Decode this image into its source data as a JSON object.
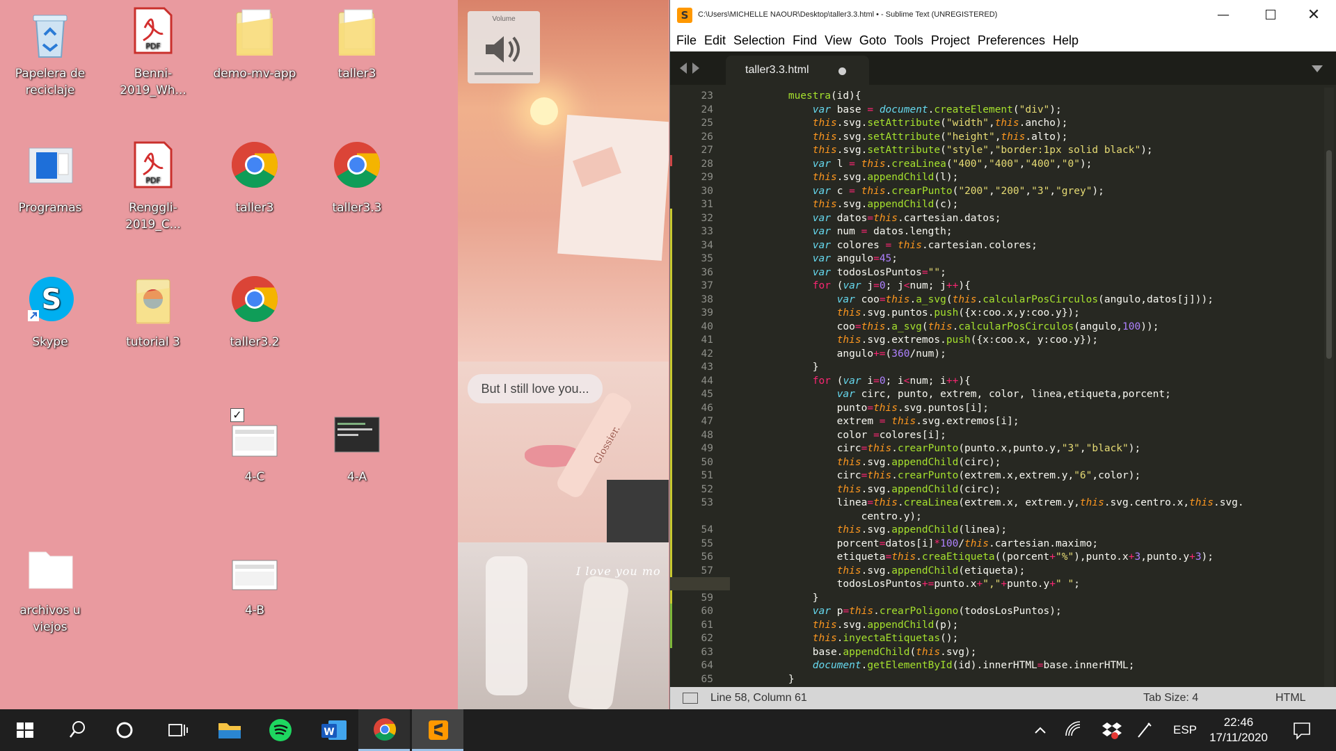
{
  "desktop": {
    "icons": [
      {
        "label": "Papelera de reciclaje",
        "icon": "recycle-bin-icon"
      },
      {
        "label": "Benni-2019_Wh...",
        "icon": "pdf-file-icon"
      },
      {
        "label": "demo-mv-app",
        "icon": "folder-icon"
      },
      {
        "label": "taller3",
        "icon": "folder-icon"
      },
      {
        "label": "Programas",
        "icon": "programs-icon"
      },
      {
        "label": "Renggli-2019_C...",
        "icon": "pdf-file-icon"
      },
      {
        "label": "taller3",
        "icon": "chrome-icon"
      },
      {
        "label": "taller3.3",
        "icon": "chrome-icon"
      },
      {
        "label": "Skype",
        "icon": "skype-icon"
      },
      {
        "label": "tutorial 3",
        "icon": "folder-icon"
      },
      {
        "label": "taller3.2",
        "icon": "chrome-icon"
      },
      {
        "label": "4-C",
        "icon": "screenshot-icon"
      },
      {
        "label": "4-A",
        "icon": "screenshot-icon"
      },
      {
        "label": "archivos u viejos",
        "icon": "folder-icon"
      },
      {
        "label": "4-B",
        "icon": "screenshot-icon"
      }
    ],
    "pdf_badge": "PDF"
  },
  "wallpaper": {
    "volume_label": "Volume",
    "bubble_text": "But I still love you...",
    "script_text": "I love you mo",
    "product_text": "Glossier."
  },
  "window": {
    "title": "C:\\Users\\MICHELLE NAOUR\\Desktop\\taller3.3.html • - Sublime Text (UNREGISTERED)",
    "menu": [
      "File",
      "Edit",
      "Selection",
      "Find",
      "View",
      "Goto",
      "Tools",
      "Project",
      "Preferences",
      "Help"
    ],
    "tab": "taller3.3.html",
    "line_numbers": [
      "23",
      "24",
      "25",
      "26",
      "27",
      "28",
      "29",
      "30",
      "31",
      "32",
      "33",
      "34",
      "35",
      "36",
      "37",
      "38",
      "39",
      "40",
      "41",
      "42",
      "43",
      "44",
      "45",
      "46",
      "47",
      "48",
      "49",
      "50",
      "51",
      "52",
      "53",
      "",
      "54",
      "55",
      "56",
      "57",
      "58",
      "59",
      "60",
      "61",
      "62",
      "63",
      "64",
      "65"
    ],
    "code_lines": [
      "        muestra(id){",
      "            var base = document.createElement(\"div\");",
      "            this.svg.setAttribute(\"width\",this.ancho);",
      "            this.svg.setAttribute(\"height\",this.alto);",
      "            this.svg.setAttribute(\"style\",\"border:1px solid black\");",
      "            var l = this.creaLinea(\"400\",\"400\",\"400\",\"0\");",
      "            this.svg.appendChild(l);",
      "            var c = this.crearPunto(\"200\",\"200\",\"3\",\"grey\");",
      "            this.svg.appendChild(c);",
      "            var datos=this.cartesian.datos;",
      "            var num = datos.length;",
      "            var colores = this.cartesian.colores;",
      "            var angulo=45;",
      "            var todosLosPuntos=\"\";",
      "            for (var j=0; j<num; j++){",
      "                var coo=this.a_svg(this.calcularPosCirculos(angulo,datos[j]));",
      "                this.svg.puntos.push({x:coo.x,y:coo.y});",
      "                coo=this.a_svg(this.calcularPosCirculos(angulo,100));",
      "                this.svg.extremos.push({x:coo.x, y:coo.y});",
      "                angulo+=(360/num);",
      "            }",
      "            for (var i=0; i<num; i++){",
      "                var circ, punto, extrem, color, linea,etiqueta,porcent;",
      "                punto=this.svg.puntos[i];",
      "                extrem = this.svg.extremos[i];",
      "                color =colores[i];",
      "                circ=this.crearPunto(punto.x,punto.y,\"3\",\"black\");",
      "                this.svg.appendChild(circ);",
      "                circ=this.crearPunto(extrem.x,extrem.y,\"6\",color);",
      "                this.svg.appendChild(circ);",
      "                linea=this.creaLinea(extrem.x, extrem.y,this.svg.centro.x,this.svg.",
      "                    centro.y);",
      "                this.svg.appendChild(linea);",
      "                porcent=datos[i]*100/this.cartesian.maximo;",
      "                etiqueta=this.creaEtiqueta((porcent+\"%\"),punto.x+3,punto.y+3);",
      "                this.svg.appendChild(etiqueta);",
      "                todosLosPuntos+=punto.x+\",\"+punto.y+\" \";",
      "            }",
      "            var p=this.crearPoligono(todosLosPuntos);",
      "            this.svg.appendChild(p);",
      "            this.inyectaEtiquetas();",
      "            base.appendChild(this.svg);",
      "            document.getElementById(id).innerHTML=base.innerHTML;",
      "        }"
    ],
    "status": {
      "position": "Line 58, Column 61",
      "tab_size": "Tab Size: 4",
      "syntax": "HTML"
    },
    "syntax_colors": {
      "keyword": "#f92672",
      "string": "#e6db74",
      "number": "#ae81ff",
      "function": "#a6e22e",
      "this": "#fd971f",
      "storage": "#66d9ef",
      "background": "#272822"
    }
  },
  "taskbar": {
    "apps": [
      "start-icon",
      "search-icon",
      "cortana-icon",
      "task-view-icon",
      "file-explorer-icon",
      "spotify-icon",
      "word-icon",
      "chrome-icon",
      "sublime-text-icon"
    ],
    "language": "ESP",
    "time": "22:46",
    "date": "17/11/2020"
  }
}
